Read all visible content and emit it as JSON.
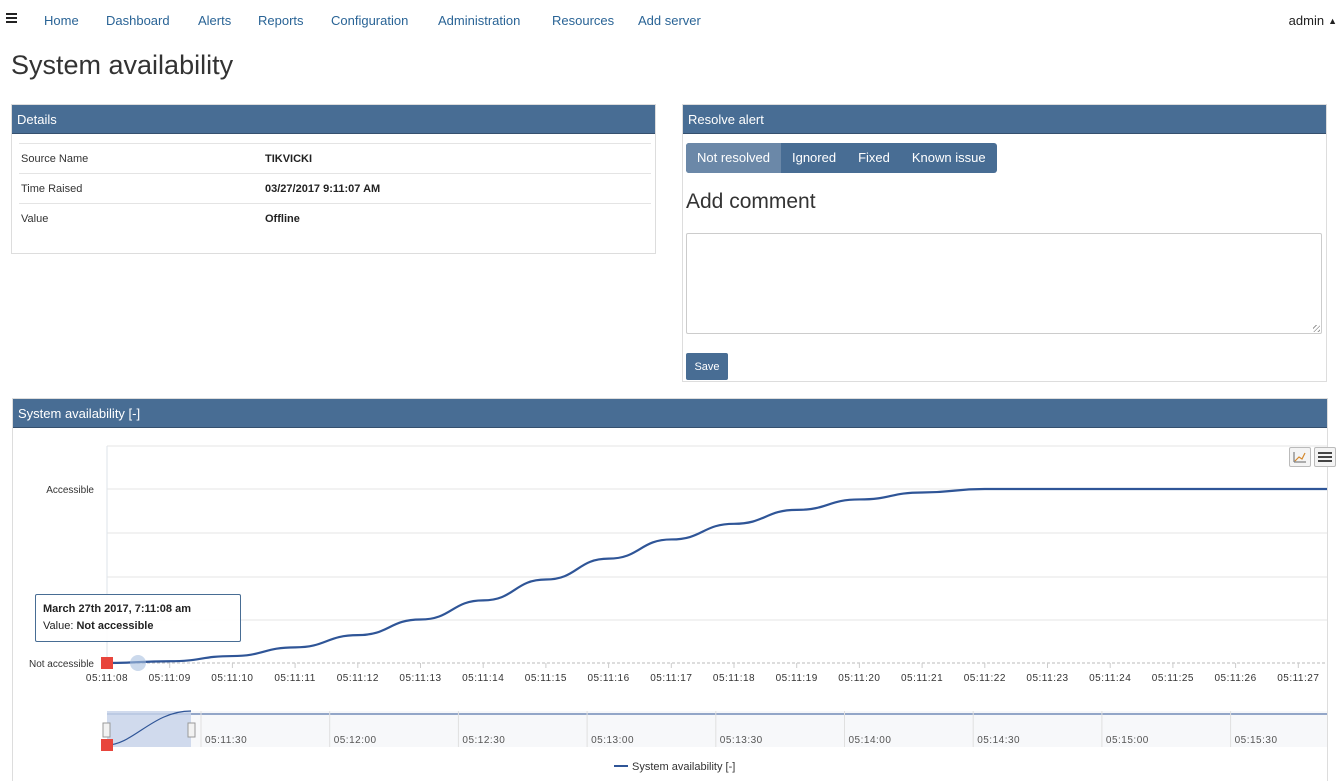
{
  "nav": {
    "items": [
      "Home",
      "Dashboard",
      "Alerts",
      "Reports",
      "Configuration",
      "Administration",
      "Resources",
      "Add server"
    ],
    "user": "admin"
  },
  "page": {
    "title": "System availability"
  },
  "details": {
    "title": "Details",
    "rows": [
      {
        "label": "Source Name",
        "value": "TIKVICKI"
      },
      {
        "label": "Time Raised",
        "value": "03/27/2017 9:11:07 AM"
      },
      {
        "label": "Value",
        "value": "Offline"
      }
    ]
  },
  "resolve": {
    "title": "Resolve alert",
    "options": [
      "Not resolved",
      "Ignored",
      "Fixed",
      "Known issue"
    ],
    "selected": "Not resolved",
    "comment_heading": "Add comment",
    "comment_value": "",
    "save_label": "Save"
  },
  "chart_panel": {
    "title": "System availability [-]",
    "tooltip": {
      "title": "March 27th 2017, 7:11:08 am",
      "value_label": "Value:",
      "value": "Not accessible"
    },
    "legend": "System availability [-]"
  },
  "colors": {
    "panel_header": "#486d94",
    "series_line": "#2f5597",
    "marker": "#e8453c",
    "link": "#2a6496"
  },
  "chart_data": {
    "type": "line",
    "title": "",
    "y_categories": [
      "Not accessible",
      "Accessible"
    ],
    "x_ticks": [
      "05:11:08",
      "05:11:09",
      "05:11:10",
      "05:11:11",
      "05:11:12",
      "05:11:13",
      "05:11:14",
      "05:11:15",
      "05:11:16",
      "05:11:17",
      "05:11:18",
      "05:11:19",
      "05:11:20",
      "05:11:21",
      "05:11:22",
      "05:11:23",
      "05:11:24",
      "05:11:25",
      "05:11:26",
      "05:11:27"
    ],
    "series": [
      {
        "name": "System availability [-]",
        "x": [
          "05:11:08",
          "05:11:09",
          "05:11:10",
          "05:11:11",
          "05:11:12",
          "05:11:13",
          "05:11:14",
          "05:11:15",
          "05:11:16",
          "05:11:17",
          "05:11:18",
          "05:11:19",
          "05:11:20",
          "05:11:21",
          "05:11:22",
          "05:11:23",
          "05:11:24",
          "05:11:25",
          "05:11:26",
          "05:11:27"
        ],
        "y": [
          0,
          0.01,
          0.04,
          0.09,
          0.16,
          0.25,
          0.36,
          0.48,
          0.6,
          0.71,
          0.8,
          0.88,
          0.94,
          0.98,
          1,
          1,
          1,
          1,
          1,
          1
        ]
      }
    ],
    "ylim": [
      0,
      1
    ],
    "grid": true,
    "legend_position": "bottom-center",
    "navigator": {
      "x_ticks": [
        "05:11:30",
        "05:12:00",
        "05:12:30",
        "05:13:00",
        "05:13:30",
        "05:14:00",
        "05:14:30",
        "05:15:00",
        "05:15:30"
      ],
      "selection": [
        "05:11:08",
        "05:11:27"
      ]
    }
  }
}
